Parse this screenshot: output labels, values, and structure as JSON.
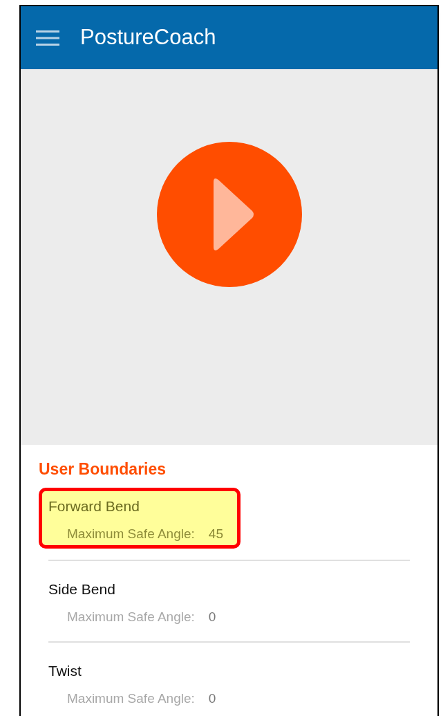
{
  "app_bar": {
    "title": "PostureCoach"
  },
  "section": {
    "title": "User Boundaries"
  },
  "boundaries": [
    {
      "name": "Forward Bend",
      "label": "Maximum Safe Angle:",
      "value": "45",
      "highlighted": true
    },
    {
      "name": "Side Bend",
      "label": "Maximum Safe Angle:",
      "value": "0",
      "highlighted": false
    },
    {
      "name": "Twist",
      "label": "Maximum Safe Angle:",
      "value": "0",
      "highlighted": false
    }
  ]
}
